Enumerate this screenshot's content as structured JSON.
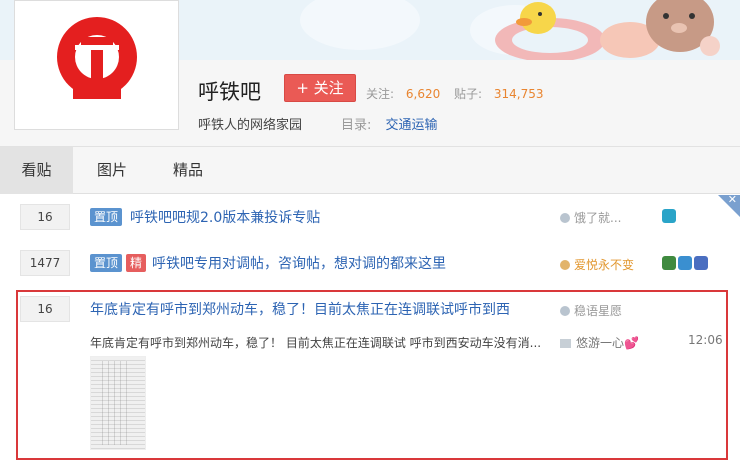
{
  "forum": {
    "name": "呼铁吧",
    "follow_label": "+ 关注",
    "followers_label": "关注:",
    "followers_count": "6,620",
    "posts_label": "贴子:",
    "posts_count": "314,753",
    "slogan": "呼铁人的网络家园",
    "catalog_label": "目录:",
    "catalog_value": "交通运输"
  },
  "tabs": [
    {
      "label": "看贴",
      "active": true
    },
    {
      "label": "图片",
      "active": false
    },
    {
      "label": "精品",
      "active": false
    }
  ],
  "close_label": "✕",
  "threads": [
    {
      "reply_count": "16",
      "badges": [
        "置顶"
      ],
      "title": "呼铁吧吧规2.0版本兼投诉专贴",
      "author": "饿了就...",
      "level_icons": [
        "#2aa4c8"
      ]
    },
    {
      "reply_count": "1477",
      "badges": [
        "置顶",
        "精"
      ],
      "title": "呼铁吧专用对调帖，咨询帖，想对调的都来这里",
      "author": "爱悦永不变",
      "level_icons": [
        "#3f8a3f",
        "#3a8fd0",
        "#4a6ec0"
      ]
    },
    {
      "reply_count": "16",
      "title": "年底肯定有呼市到郑州动车，稳了！目前太焦正在连调联试呼市到西",
      "author": "稳语星愿",
      "excerpt": "年底肯定有呼市到郑州动车，稳了！ 目前太焦正在连调联试 呼市到西安动车没有消...",
      "last_reply_user": "悠游一心💕",
      "time": "12:06"
    }
  ],
  "colors": {
    "accent_red": "#ea5a55",
    "link_blue": "#2d64b3",
    "count_orange": "#e98530",
    "highlight_border": "#d9383a"
  }
}
